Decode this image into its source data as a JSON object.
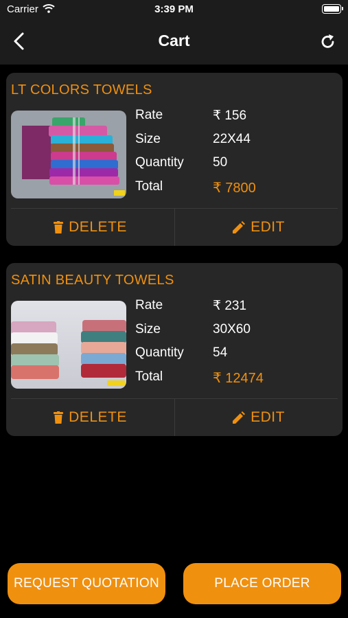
{
  "status_bar": {
    "carrier": "Carrier",
    "time": "3:39 PM"
  },
  "nav": {
    "title": "Cart"
  },
  "cart_items": [
    {
      "name": "LT COLORS TOWELS",
      "rate_label": "Rate",
      "rate": "₹ 156",
      "size_label": "Size",
      "size": "22X44",
      "quantity_label": "Quantity",
      "quantity": "50",
      "total_label": "Total",
      "total": "₹ 7800",
      "delete_label": "DELETE",
      "edit_label": "EDIT"
    },
    {
      "name": "SATIN BEAUTY TOWELS",
      "rate_label": "Rate",
      "rate": "₹ 231",
      "size_label": "Size",
      "size": "30X60",
      "quantity_label": "Quantity",
      "quantity": "54",
      "total_label": "Total",
      "total": "₹ 12474",
      "delete_label": "DELETE",
      "edit_label": "EDIT"
    }
  ],
  "actions": {
    "request_quotation": "REQUEST QUOTATION",
    "place_order": "PLACE ORDER"
  },
  "colors": {
    "accent": "#f0900f",
    "card": "#272727",
    "bar": "#1c1c1c",
    "background": "#000000"
  },
  "icons": {
    "back": "chevron-left-icon",
    "refresh": "refresh-icon",
    "delete": "trash-icon",
    "edit": "pencil-icon",
    "wifi": "wifi-icon",
    "battery": "battery-icon"
  }
}
